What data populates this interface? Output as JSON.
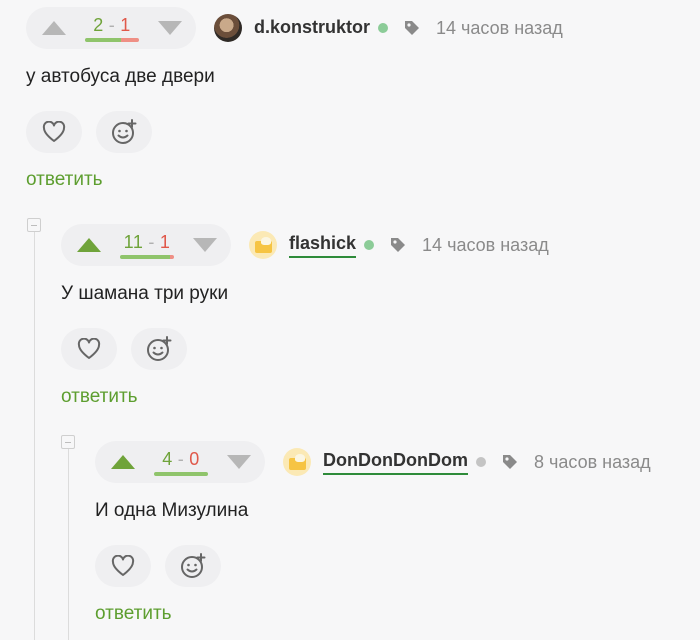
{
  "comments": [
    {
      "rating": {
        "plus": "2",
        "sep": "-",
        "minus": "1",
        "positive_share": 0.67
      },
      "username": "d.konstruktor",
      "time": "14 часов назад",
      "text": "у автобуса две двери",
      "reply_label": "ответить"
    },
    {
      "rating": {
        "plus": "11",
        "sep": "-",
        "minus": "1",
        "positive_share": 0.92
      },
      "username": "flashick",
      "time": "14 часов назад",
      "text": "У шамана три руки",
      "reply_label": "ответить"
    },
    {
      "rating": {
        "plus": "4",
        "sep": "-",
        "minus": "0",
        "positive_share": 1.0
      },
      "username": "DonDonDonDom",
      "time": "8 часов назад",
      "text": "И одна Мизулина",
      "reply_label": "ответить"
    }
  ],
  "icons": {
    "upvote": "arrow-up-icon",
    "downvote": "arrow-down-icon",
    "like": "heart-icon",
    "react": "emoji-add-icon",
    "tag": "tag-icon",
    "collapse": "minus-square-icon"
  },
  "colors": {
    "accent_green": "#5d9e2f",
    "upvote_active": "#6fa33a",
    "minus_red": "#e0584a",
    "online": "#8ccc98"
  }
}
